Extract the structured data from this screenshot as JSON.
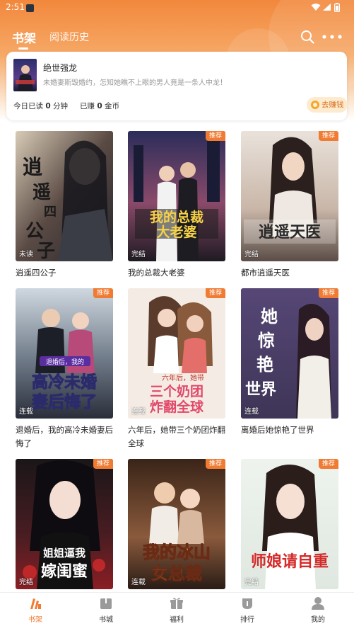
{
  "status_bar": {
    "time": "2:51"
  },
  "header": {
    "tabs": [
      {
        "label": "书架",
        "active": true
      },
      {
        "label": "阅读历史",
        "active": false
      }
    ],
    "icons": [
      "search-icon",
      "more-icon"
    ]
  },
  "reading_card": {
    "title": "绝世强龙",
    "description": "未婚妻斯毁婚约，怎知她瞧不上眼的男人竟是一条人中龙！",
    "read_today_prefix": "今日已读",
    "read_today_value": "0",
    "read_today_unit": "分钟",
    "earned_prefix": "已赚",
    "earned_value": "0",
    "earned_unit": "金币",
    "earn_button": "去赚钱"
  },
  "books": [
    {
      "title": "逍遥四公子",
      "status": "未读",
      "badge": "",
      "cover_text": "逍遥四公子"
    },
    {
      "title": "我的总裁大老婆",
      "status": "完结",
      "badge": "推荐",
      "cover_text": "我的总裁大老婆"
    },
    {
      "title": "都市逍遥天医",
      "status": "完结",
      "badge": "推荐",
      "cover_text": "逍遥天医"
    },
    {
      "title": "退婚后，我的高冷未婚妻后悔了",
      "status": "连载",
      "badge": "推荐",
      "cover_text": "高冷未婚妻后悔了"
    },
    {
      "title": "六年后，她带三个奶团炸翻全球",
      "status": "连载",
      "badge": "推荐",
      "cover_text": "三个奶团炸翻全球"
    },
    {
      "title": "离婚后她惊艳了世界",
      "status": "连载",
      "badge": "推荐",
      "cover_text": "她惊艳了世界"
    },
    {
      "title": "",
      "status": "完结",
      "badge": "推荐",
      "cover_text": "姐姐逼我嫁闺蜜"
    },
    {
      "title": "",
      "status": "连载",
      "badge": "推荐",
      "cover_text": "我的冰山女总裁"
    },
    {
      "title": "",
      "status": "完结",
      "badge": "推荐",
      "cover_text": "师娘请自重"
    }
  ],
  "bottom_nav": [
    {
      "label": "书架",
      "icon": "bookshelf-icon",
      "active": true
    },
    {
      "label": "书城",
      "icon": "bookstore-icon",
      "active": false
    },
    {
      "label": "福利",
      "icon": "gift-icon",
      "active": false
    },
    {
      "label": "排行",
      "icon": "ranking-icon",
      "active": false
    },
    {
      "label": "我的",
      "icon": "profile-icon",
      "active": false
    }
  ],
  "colors": {
    "accent": "#f07b33",
    "header_orange": "#f2883c"
  }
}
